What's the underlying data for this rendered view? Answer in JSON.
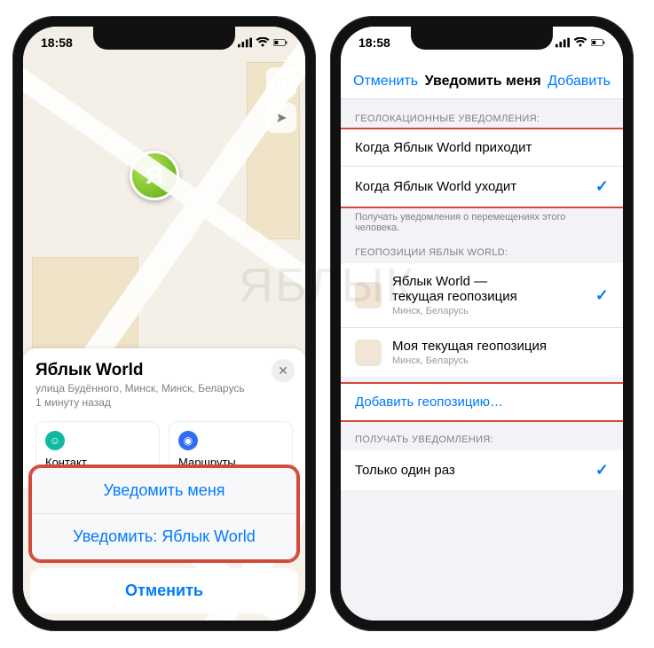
{
  "status": {
    "time": "18:58",
    "net": "7"
  },
  "watermark": "ЯБЛЫК",
  "left": {
    "map": {
      "pin_initial": "Я",
      "info_button_name": "info",
      "locate_button_name": "locate"
    },
    "sheet": {
      "title": "Яблык World",
      "address": "улица Будённого, Минск, Минск, Беларусь",
      "updated": "1 минуту назад",
      "cards": {
        "contact": "Контакт",
        "routes": "Маршруты"
      }
    },
    "actions": {
      "notify_me": "Уведомить меня",
      "notify_other": "Уведомить: Яблык World",
      "cancel": "Отменить"
    }
  },
  "right": {
    "nav": {
      "cancel": "Отменить",
      "title": "Уведомить меня",
      "add": "Добавить"
    },
    "sections": {
      "geo_notifications_label": "ГЕОЛОКАЦИОННЫЕ УВЕДОМЛЕНИЯ:",
      "arrives": "Когда Яблык World приходит",
      "leaves": "Когда Яблык World уходит",
      "geo_notifications_footer": "Получать уведомления о перемещениях этого человека.",
      "positions_label": "ГЕОПОЗИЦИИ ЯБЛЫК WORLD:",
      "position_current_title": "Яблык World —\nтекущая геопозиция",
      "position_current_sub": "Минск, Беларусь",
      "position_mine_title": "Моя текущая геопозиция",
      "position_mine_sub": "Минск, Беларусь",
      "add_position": "Добавить геопозицию…",
      "receive_label": "ПОЛУЧАТЬ УВЕДОМЛЕНИЯ:",
      "only_once": "Только один раз"
    }
  }
}
